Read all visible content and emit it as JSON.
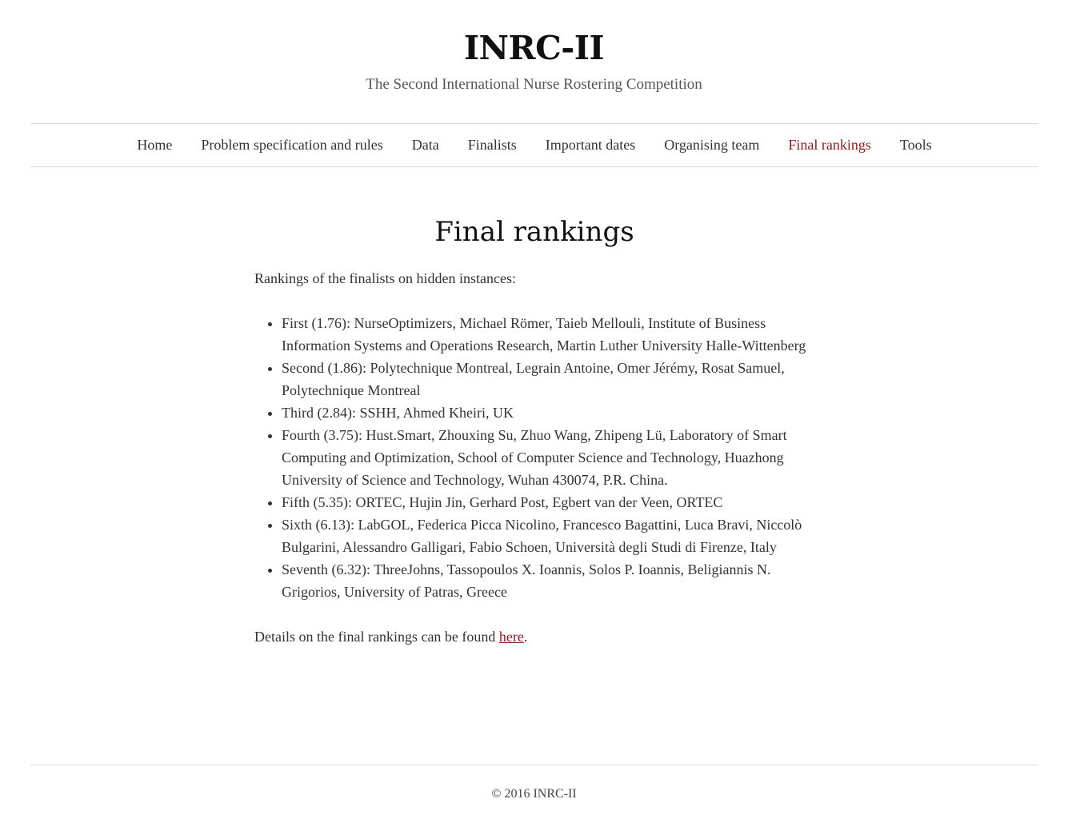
{
  "site": {
    "title": "INRC-II",
    "tagline": "The Second International Nurse Rostering Competition"
  },
  "nav": {
    "items": [
      {
        "label": "Home"
      },
      {
        "label": "Problem specification and rules"
      },
      {
        "label": "Data"
      },
      {
        "label": "Finalists"
      },
      {
        "label": "Important dates"
      },
      {
        "label": "Organising team"
      },
      {
        "label": "Final rankings",
        "active": true
      },
      {
        "label": "Tools"
      }
    ]
  },
  "main": {
    "title": "Final rankings",
    "intro": "Rankings of the finalists on hidden instances:",
    "rankings": [
      "First (1.76): NurseOptimizers, Michael Römer, Taieb Mellouli, Institute of Business Information Systems and Operations Research, Martin Luther University Halle-Wittenberg",
      "Second (1.86): Polytechnique Montreal, Legrain Antoine, Omer Jérémy, Rosat Samuel, Polytechnique Montreal",
      "Third (2.84): SSHH, Ahmed Kheiri, UK",
      "Fourth (3.75): Hust.Smart, Zhouxing Su, Zhuo Wang, Zhipeng Lü, Laboratory of Smart Computing and Optimization, School of Computer Science and Technology, Huazhong University of Science and Technology, Wuhan 430074, P.R. China.",
      "Fifth (5.35): ORTEC, Hujin Jin, Gerhard Post, Egbert van der Veen, ORTEC",
      "Sixth (6.13): LabGOL, Federica Picca Nicolino, Francesco Bagattini, Luca Bravi, Niccolò Bulgarini, Alessandro Galligari, Fabio Schoen, Università degli Studi di Firenze, Italy",
      "Seventh (6.32): ThreeJohns, Tassopoulos X. Ioannis, Solos P. Ioannis, Beligiannis N. Grigorios, University of Patras, Greece"
    ],
    "details_prefix": "Details on the final rankings can be found ",
    "details_link": "here",
    "details_suffix": "."
  },
  "footer": {
    "text": "© 2016 INRC-II"
  },
  "colors": {
    "accent": "#8b1a1a",
    "text": "#333333",
    "divider": "#dddddd"
  }
}
